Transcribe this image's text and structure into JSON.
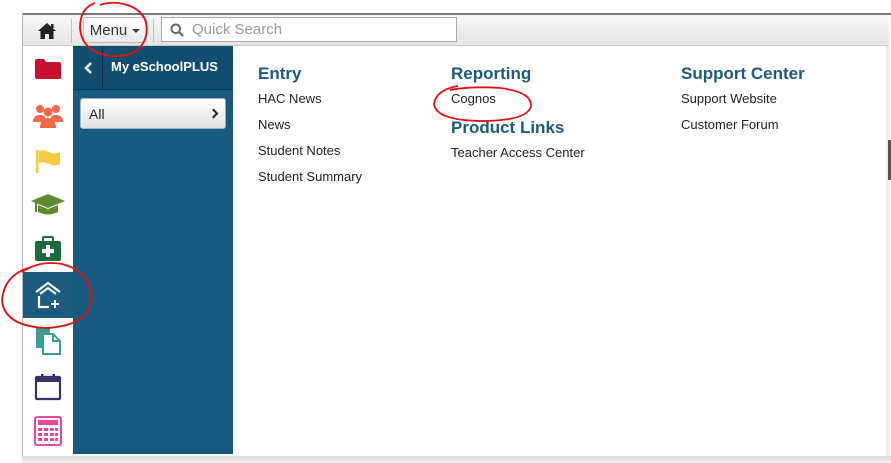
{
  "toolbar": {
    "menu_label": "Menu",
    "search_placeholder": "Quick Search"
  },
  "nav": {
    "title": "My eSchoolPLUS",
    "filter_label": "All"
  },
  "rail": {
    "icons": [
      "folder-icon",
      "people-icon",
      "flag-icon",
      "graduation-cap-icon",
      "medical-kit-icon",
      "home-add-icon",
      "document-icon",
      "calendar-icon",
      "calculator-icon"
    ],
    "active": "home-add-icon"
  },
  "menu": {
    "entry": {
      "heading": "Entry",
      "links": [
        "HAC News",
        "News",
        "Student Notes",
        "Student Summary"
      ]
    },
    "reporting": {
      "heading": "Reporting",
      "links": [
        "Cognos"
      ]
    },
    "product_links": {
      "heading": "Product Links",
      "links": [
        "Teacher Access Center"
      ]
    },
    "support_center": {
      "heading": "Support Center",
      "links": [
        "Support Website",
        "Customer Forum"
      ]
    }
  },
  "colors": {
    "nav_blue": "#175a80",
    "heading_blue": "#1c5a7e",
    "annotation_red": "#e01010"
  }
}
